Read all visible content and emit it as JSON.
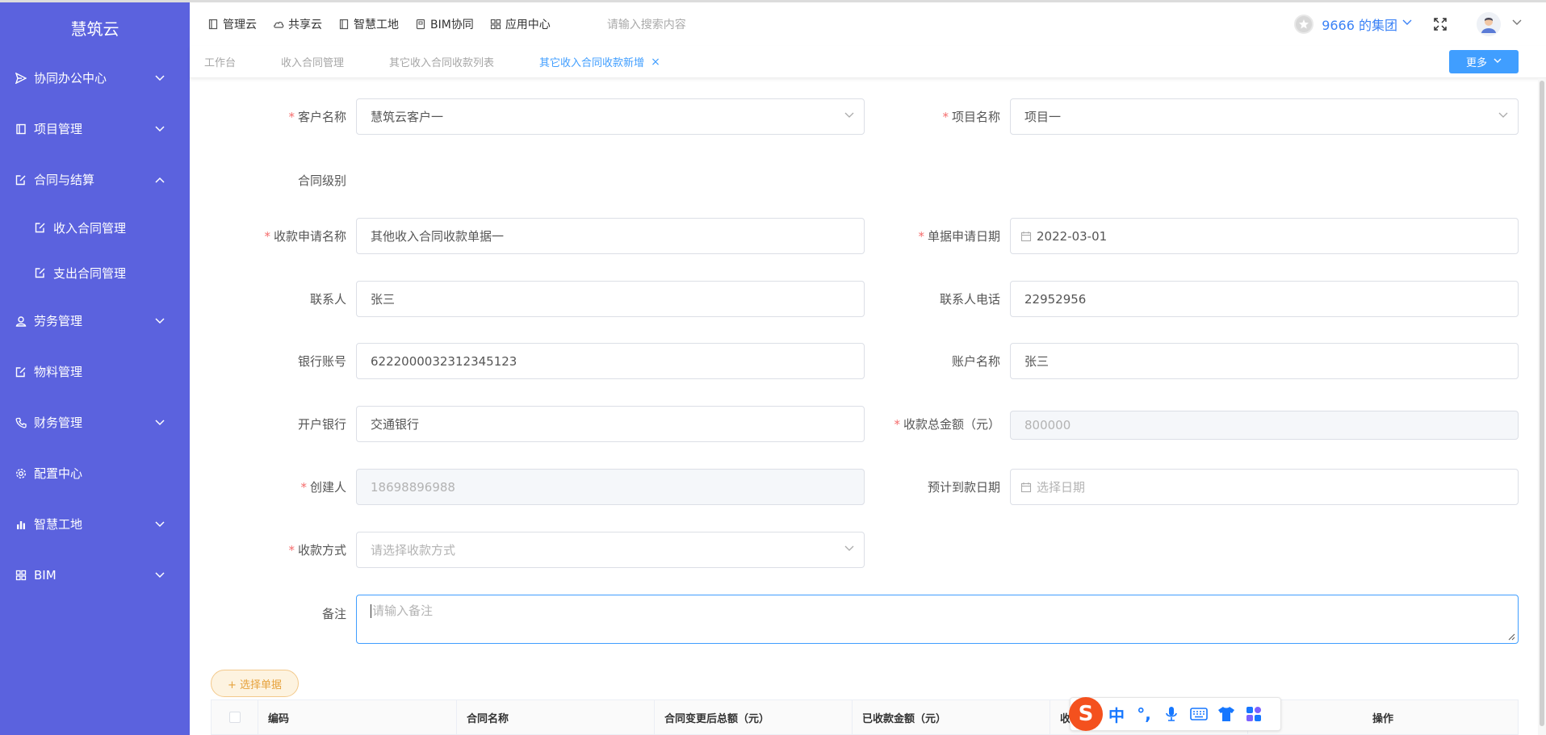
{
  "sidebar": {
    "brand": "慧筑云",
    "items": [
      {
        "label": "协同办公中心",
        "icon": "send-icon",
        "expanded": false
      },
      {
        "label": "项目管理",
        "icon": "book-icon",
        "expanded": false
      },
      {
        "label": "合同与结算",
        "icon": "edit-icon",
        "expanded": true
      },
      {
        "label": "劳务管理",
        "icon": "worker-icon",
        "expanded": false
      },
      {
        "label": "物料管理",
        "icon": "edit-icon"
      },
      {
        "label": "财务管理",
        "icon": "phone-icon",
        "expanded": false
      },
      {
        "label": "配置中心",
        "icon": "gear-icon"
      },
      {
        "label": "智慧工地",
        "icon": "bar-chart-icon",
        "expanded": false
      },
      {
        "label": "BIM",
        "icon": "grid-icon",
        "expanded": false
      }
    ],
    "sub_items": [
      {
        "label": "收入合同管理",
        "icon": "edit-icon"
      },
      {
        "label": "支出合同管理",
        "icon": "edit-icon"
      }
    ]
  },
  "header": {
    "nav": [
      {
        "label": "管理云",
        "icon": "book-icon"
      },
      {
        "label": "共享云",
        "icon": "cloud-icon"
      },
      {
        "label": "智慧工地",
        "icon": "book-icon"
      },
      {
        "label": "BIM协同",
        "icon": "file-icon"
      },
      {
        "label": "应用中心",
        "icon": "grid-icon"
      }
    ],
    "search_placeholder": "请输入搜索内容",
    "org_name": "9666 的集团"
  },
  "tabs": {
    "items": [
      {
        "label": "工作台",
        "active": false
      },
      {
        "label": "收入合同管理",
        "active": false
      },
      {
        "label": "其它收入合同收款列表",
        "active": false
      },
      {
        "label": "其它收入合同收款新增",
        "active": true
      }
    ],
    "close_symbol": "×",
    "more_label": "更多"
  },
  "form": {
    "customer": {
      "label": "客户名称",
      "value": "慧筑云客户一"
    },
    "project": {
      "label": "项目名称",
      "value": "项目一"
    },
    "contract_level": {
      "label": "合同级别"
    },
    "apply_name": {
      "label": "收款申请名称",
      "value": "其他收入合同收款单据一"
    },
    "apply_date": {
      "label": "单据申请日期",
      "value": "2022-03-01"
    },
    "contact": {
      "label": "联系人",
      "value": "张三"
    },
    "contact_phone": {
      "label": "联系人电话",
      "value": "22952956"
    },
    "bank_account": {
      "label": "银行账号",
      "value": "6222000032312345123"
    },
    "account_name": {
      "label": "账户名称",
      "value": "张三"
    },
    "bank": {
      "label": "开户银行",
      "value": "交通银行"
    },
    "total_amount": {
      "label": "收款总金额（元）",
      "value": "800000"
    },
    "creator": {
      "label": "创建人",
      "value": "18698896988"
    },
    "expected_date": {
      "label": "预计到款日期",
      "placeholder": "选择日期"
    },
    "pay_method": {
      "label": "收款方式",
      "placeholder": "请选择收款方式"
    },
    "remark": {
      "label": "备注",
      "placeholder": "请输入备注"
    },
    "required_mark": "*"
  },
  "select_doc_button": "+ 选择单据",
  "table": {
    "columns": [
      "编码",
      "合同名称",
      "合同变更后总额（元）",
      "已收款金额（元）",
      "收",
      "",
      "操作"
    ]
  },
  "ime": {
    "logo": "S",
    "items": [
      "中",
      "°,"
    ]
  },
  "colors": {
    "sidebar": "#5b62de",
    "primary": "#409eff",
    "required": "#f56c6c",
    "warning": "#e6a23c"
  }
}
